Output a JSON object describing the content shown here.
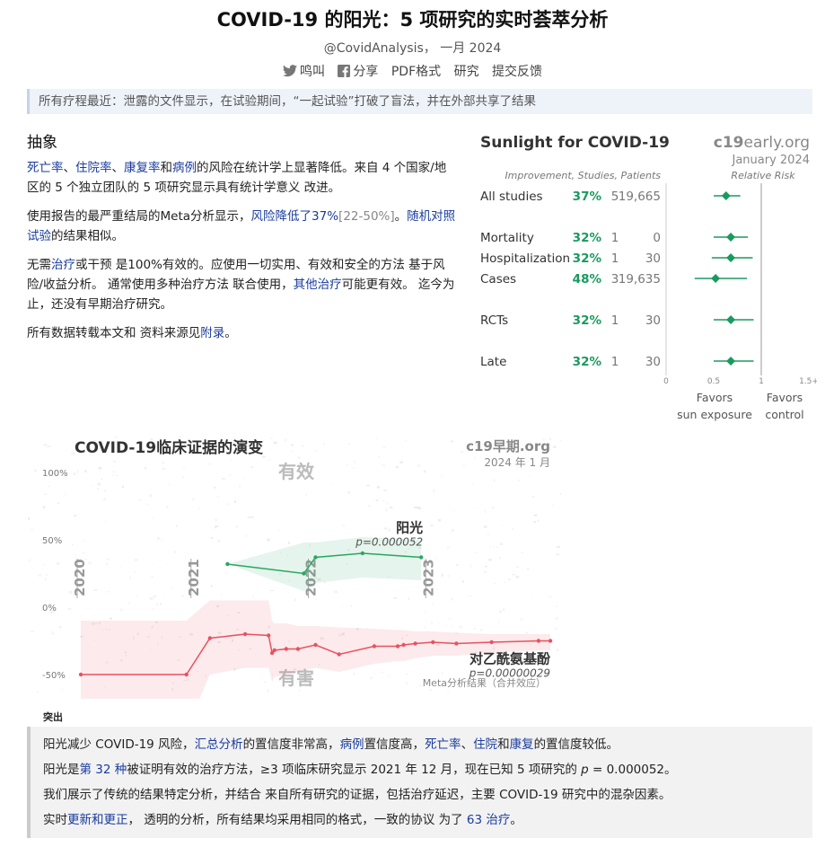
{
  "header": {
    "title": "COVID-19 的阳光：5 项研究的实时荟萃分析",
    "byline": "@CovidAnalysis， 一月 2024",
    "actions": [
      "鸣叫",
      "分享",
      "PDF格式",
      "研究",
      "提交反馈"
    ]
  },
  "notice": "所有疗程最近：泄露的文件显示，在试验期间，“一起试验”打破了盲法，并在外部共享了结果",
  "abstract": {
    "heading": "抽象",
    "p1": {
      "l1": "死亡率",
      "s1": "、",
      "l2": "住院率",
      "s2": "、",
      "l3": "康复率",
      "s3": "和",
      "l4": "病例",
      "s4": "的风险在统计学上显著降低。来自 4 个国家/地区的 5 个独立团队的 5 项研究显示具有统计学意义 改进。"
    },
    "p2": {
      "s1": "使用报告的最严重结局的Meta分析显示，",
      "l1": "风险降低了37%",
      "g1": "[22-50%]",
      "s2": "。",
      "l2": "随机对照试验",
      "s3": "的结果相似。"
    },
    "p3": {
      "s1": "无需",
      "l1": "治疗",
      "s2": "或干预 是100%有效的。应使用一切实用、有效和安全的方法 基于风险/收益分析。 通常使用多种治疗方法 联合使用，",
      "l2": "其他治疗",
      "s3": "可能更有效。 迄今为止，还没有早期治疗研究。"
    },
    "p4": {
      "s1": "所有数据转载本文和 资料来源见",
      "l1": "附录",
      "s2": "。"
    }
  },
  "forest": {
    "title": "Sunlight for COVID-19",
    "brand_bold": "c19",
    "brand_rest": "early.org",
    "date": "January 2024",
    "col_header": "Improvement, Studies, Patients",
    "rr_header": "Relative Risk",
    "green": "#1a9a5e",
    "rows": [
      {
        "label": "All studies",
        "pct": "37%",
        "studies": "5",
        "patients": "19,665",
        "rr": 0.63,
        "lo": 0.5,
        "hi": 0.78
      },
      {
        "label": "Mortality",
        "pct": "32%",
        "studies": "1",
        "patients": "0",
        "rr": 0.68,
        "lo": 0.5,
        "hi": 0.86
      },
      {
        "label": "Hospitalization",
        "pct": "32%",
        "studies": "1",
        "patients": "30",
        "rr": 0.68,
        "lo": 0.48,
        "hi": 0.91
      },
      {
        "label": "Cases",
        "pct": "48%",
        "studies": "3",
        "patients": "19,635",
        "rr": 0.52,
        "lo": 0.3,
        "hi": 0.85
      },
      {
        "label": "RCTs",
        "pct": "32%",
        "studies": "1",
        "patients": "30",
        "rr": 0.68,
        "lo": 0.5,
        "hi": 0.92
      },
      {
        "label": "Late",
        "pct": "32%",
        "studies": "1",
        "patients": "30",
        "rr": 0.68,
        "lo": 0.5,
        "hi": 0.92
      }
    ],
    "ticks": [
      "0",
      "0.5",
      "1",
      "1.5+"
    ],
    "favors_left_1": "Favors",
    "favors_left_2": "sun exposure",
    "favors_right_1": "Favors",
    "favors_right_2": "control"
  },
  "chart_data": [
    {
      "type": "line",
      "title": "COVID-19临床证据的演变",
      "brand": "c19早期.org",
      "date": "2024 年 1 月",
      "effective_label": "有效",
      "harmful_label": "有害",
      "ylim": [
        -60,
        100
      ],
      "xlim": [
        2020.0,
        2024.0
      ],
      "y_ticks": [
        "100%",
        "50%",
        "0%",
        "-50%"
      ],
      "x_ticks": [
        "2020",
        "2021",
        "2022",
        "2023"
      ],
      "footnote": "Meta分析结果（合并效应）",
      "series": [
        {
          "name": "阳光",
          "pvalue": "p=0.000052",
          "color": "#27a85f",
          "x": [
            2021.25,
            2021.9,
            2022.0,
            2022.4,
            2022.9
          ],
          "y": [
            32,
            25,
            37,
            40,
            37
          ],
          "band_upper": [
            32,
            48,
            48,
            52,
            50
          ],
          "band_lower": [
            32,
            12,
            18,
            22,
            20
          ]
        },
        {
          "name": "对乙酰氨基酚",
          "pvalue": "p=0.00000029",
          "color": "#e8525f",
          "x": [
            2020.0,
            2020.9,
            2021.1,
            2021.4,
            2021.6,
            2021.63,
            2021.65,
            2021.75,
            2021.85,
            2022.0,
            2022.2,
            2022.5,
            2022.7,
            2022.75,
            2022.85,
            2023.0,
            2023.2,
            2023.5,
            2023.9,
            2024.0
          ],
          "y": [
            -50,
            -50,
            -23,
            -20,
            -21,
            -34,
            -32,
            -31,
            -31,
            -28,
            -35,
            -29,
            -29,
            -28,
            -27,
            -26,
            -27,
            -26,
            -25,
            -25
          ],
          "band_upper": [
            -10,
            -10,
            5,
            5,
            5,
            -10,
            -12,
            -12,
            -14,
            -14,
            -15,
            -16,
            -17,
            -17,
            -18,
            -18,
            -19,
            -20,
            -20,
            -20
          ],
          "band_lower": [
            -90,
            -90,
            -50,
            -45,
            -45,
            -55,
            -52,
            -50,
            -48,
            -45,
            -48,
            -42,
            -40,
            -40,
            -38,
            -36,
            -36,
            -34,
            -32,
            -32
          ]
        }
      ]
    }
  ],
  "highlights": {
    "title": "突出",
    "line1": {
      "s1": "阳光减少 COVID-19 风险，",
      "l1": "汇总分析",
      "s2": "的置信度非常高，",
      "l2": "病例",
      "s3": "置信度高，",
      "l3": "死亡率",
      "s4": "、",
      "l4": "住院",
      "s5": "和",
      "l5": "康复",
      "s6": "的置信度较低。"
    },
    "line2": {
      "s1": "阳光是",
      "l1": "第 32 种",
      "s2": "被证明有效的治疗方法，≥3 项临床研究显示 2021 年 12 月，现在已知 5 项研究的 ",
      "s3": "p",
      "s4": " = 0.000052。"
    },
    "line3": "我们展示了传统的结果特定分析，并结合 来自所有研究的证据，包括治疗延迟，主要 COVID-19 研究中的混杂因素。",
    "line4": {
      "s1": "实时",
      "l1": "更新和更正",
      "s2": "， 透明的分析，所有结果均采用相同的格式，一致的协议 为了 ",
      "l2": "63 治疗",
      "s3": "。"
    }
  }
}
